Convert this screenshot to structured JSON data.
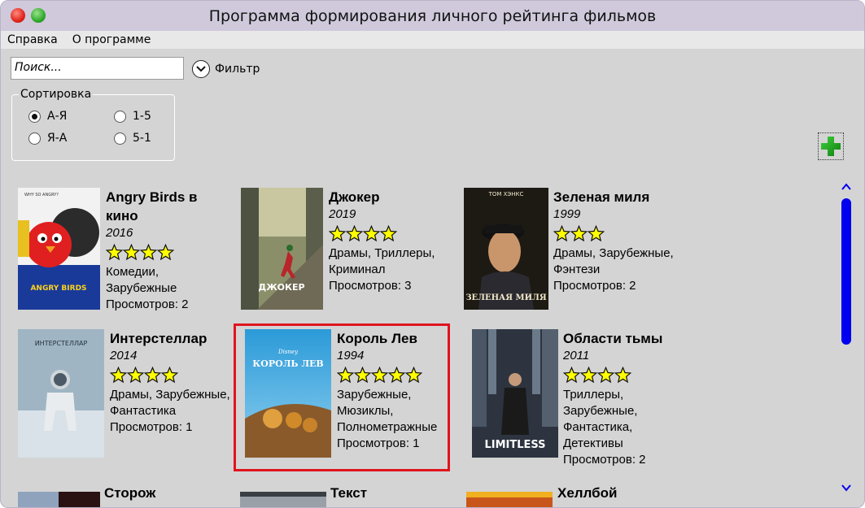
{
  "window": {
    "title": "Программа формирования личного рейтинга фильмов"
  },
  "menu": {
    "items": [
      "Справка",
      "О программе"
    ]
  },
  "search": {
    "placeholder": "Поиск..."
  },
  "filter": {
    "label": "Фильтр"
  },
  "sort": {
    "legend": "Сортировка",
    "options": [
      {
        "label": "А-Я",
        "selected": true
      },
      {
        "label": "Я-А",
        "selected": false
      },
      {
        "label": "1-5",
        "selected": false
      },
      {
        "label": "5-1",
        "selected": false
      }
    ]
  },
  "accent": {
    "selection": "#e0141e",
    "scroll": "#0000f0",
    "star": "#ffff00",
    "add": "#1aa31a"
  },
  "movies": [
    {
      "title_lines": [
        "Angry Birds в",
        "кино"
      ],
      "year": "2016",
      "rating": 4,
      "genre_lines": [
        "Комедии,",
        "Зарубежные"
      ],
      "views": "Просмотров: 2"
    },
    {
      "title_lines": [
        "Джокер"
      ],
      "year": "2019",
      "rating": 4,
      "genre_lines": [
        "Драмы, Триллеры,",
        "Криминал"
      ],
      "views": "Просмотров: 3"
    },
    {
      "title_lines": [
        "Зеленая миля"
      ],
      "year": "1999",
      "rating": 3,
      "genre_lines": [
        "Драмы, Зарубежные,",
        "Фэнтези"
      ],
      "views": "Просмотров: 2"
    },
    {
      "title_lines": [
        "Интерстеллар"
      ],
      "year": "2014",
      "rating": 4,
      "genre_lines": [
        "Драмы, Зарубежные,",
        "Фантастика"
      ],
      "views": "Просмотров: 1"
    },
    {
      "title_lines": [
        "Король Лев"
      ],
      "year": "1994",
      "rating": 5,
      "genre_lines": [
        "Зарубежные,",
        "Мюзиклы,",
        "Полнометражные"
      ],
      "views": "Просмотров: 1"
    },
    {
      "title_lines": [
        "Области тьмы"
      ],
      "year": "2011",
      "rating": 4,
      "genre_lines": [
        "Триллеры,",
        "Зарубежные,",
        "Фантастика,",
        "Детективы"
      ],
      "views": "Просмотров: 2"
    },
    {
      "title_lines": [
        "Сторож"
      ]
    },
    {
      "title_lines": [
        "Текст"
      ]
    },
    {
      "title_lines": [
        "Хеллбой"
      ]
    }
  ],
  "posters": {
    "angry": {
      "top_text": "WHY SO ANGRY?",
      "logo": "ANGRY BIRDS"
    },
    "joker": {
      "title": "ДЖОКЕР"
    },
    "green": {
      "actor": "ТОМ ХЭНКС",
      "title": "ЗЕЛЕНАЯ МИЛЯ"
    },
    "inter": {
      "title": "ИНТЕРСТЕЛЛАР"
    },
    "lion": {
      "brand": "Disney",
      "title": "КОРОЛЬ ЛЕВ"
    },
    "limitless": {
      "title": "LIMITLESS"
    }
  }
}
